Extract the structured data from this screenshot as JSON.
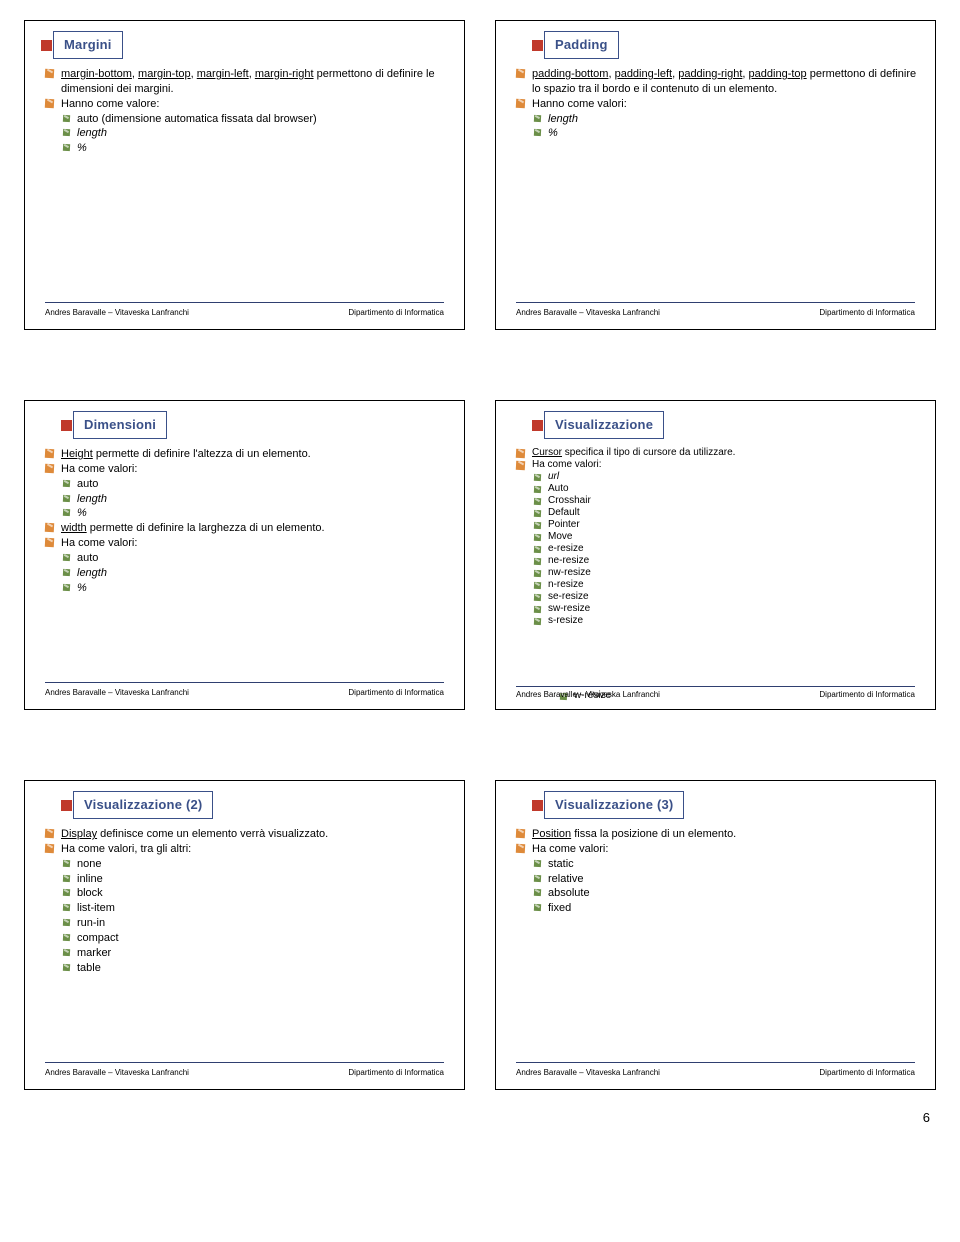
{
  "footer": {
    "left": "Andres Baravalle – Vitaveska Lanfranchi",
    "right": "Dipartimento di Informatica"
  },
  "pagenum": "6",
  "slides": [
    {
      "title": "Margini",
      "indent": false,
      "rows": [
        {
          "lvl": 1,
          "parts": [
            {
              "t": "margin-bottom",
              "c": "link"
            },
            {
              "t": ", "
            },
            {
              "t": "margin-top",
              "c": "link"
            },
            {
              "t": ", "
            },
            {
              "t": "margin-left",
              "c": "link"
            },
            {
              "t": ", "
            },
            {
              "t": "margin-right",
              "c": "link"
            },
            {
              "t": " permettono di definire le dimensioni dei margini."
            }
          ]
        },
        {
          "lvl": 1,
          "parts": [
            {
              "t": "Hanno come valore:"
            }
          ]
        },
        {
          "lvl": 2,
          "parts": [
            {
              "t": "auto (dimensione automatica fissata dal browser)"
            }
          ]
        },
        {
          "lvl": 2,
          "parts": [
            {
              "t": "length",
              "c": "em"
            }
          ]
        },
        {
          "lvl": 2,
          "parts": [
            {
              "t": "%",
              "c": "em"
            }
          ]
        }
      ]
    },
    {
      "title": "Padding",
      "indent": true,
      "rows": [
        {
          "lvl": 1,
          "parts": [
            {
              "t": "padding-bottom",
              "c": "link"
            },
            {
              "t": ", "
            },
            {
              "t": "padding-left",
              "c": "link"
            },
            {
              "t": ", "
            },
            {
              "t": "padding-right",
              "c": "link"
            },
            {
              "t": ", "
            },
            {
              "t": "padding-top",
              "c": "link"
            },
            {
              "t": " permettono di definire lo spazio tra il bordo e il contenuto di un elemento."
            }
          ]
        },
        {
          "lvl": 1,
          "parts": [
            {
              "t": "Hanno come valori:"
            }
          ]
        },
        {
          "lvl": 2,
          "parts": [
            {
              "t": "length",
              "c": "em"
            }
          ]
        },
        {
          "lvl": 2,
          "parts": [
            {
              "t": "%",
              "c": "em"
            }
          ]
        }
      ]
    },
    {
      "title": "Dimensioni",
      "indent": true,
      "rows": [
        {
          "lvl": 1,
          "parts": [
            {
              "t": "Height",
              "c": "link"
            },
            {
              "t": " permette di definire l'altezza di un elemento."
            }
          ]
        },
        {
          "lvl": 1,
          "parts": [
            {
              "t": "Ha come valori:"
            }
          ]
        },
        {
          "lvl": 2,
          "parts": [
            {
              "t": "auto"
            }
          ]
        },
        {
          "lvl": 2,
          "parts": [
            {
              "t": "length",
              "c": "em"
            }
          ]
        },
        {
          "lvl": 2,
          "parts": [
            {
              "t": "%",
              "c": "em"
            }
          ]
        },
        {
          "lvl": 1,
          "parts": [
            {
              "t": "width",
              "c": "link"
            },
            {
              "t": " permette di definire la larghezza di un elemento."
            }
          ]
        },
        {
          "lvl": 1,
          "parts": [
            {
              "t": "Ha come valori:"
            }
          ]
        },
        {
          "lvl": 2,
          "parts": [
            {
              "t": "auto"
            }
          ]
        },
        {
          "lvl": 2,
          "parts": [
            {
              "t": "length",
              "c": "em"
            }
          ]
        },
        {
          "lvl": 2,
          "parts": [
            {
              "t": "%",
              "c": "em"
            }
          ]
        }
      ]
    },
    {
      "title": "Visualizzazione",
      "indent": true,
      "tight": true,
      "overlap": "w-resize",
      "rows": [
        {
          "lvl": 1,
          "parts": [
            {
              "t": "Cursor",
              "c": "link"
            },
            {
              "t": " specifica il tipo di cursore da utilizzare."
            }
          ]
        },
        {
          "lvl": 1,
          "parts": [
            {
              "t": "Ha come valori:"
            }
          ]
        },
        {
          "lvl": 2,
          "parts": [
            {
              "t": "url",
              "c": "em"
            }
          ]
        },
        {
          "lvl": 2,
          "parts": [
            {
              "t": "Auto"
            }
          ]
        },
        {
          "lvl": 2,
          "parts": [
            {
              "t": "Crosshair"
            }
          ]
        },
        {
          "lvl": 2,
          "parts": [
            {
              "t": "Default"
            }
          ]
        },
        {
          "lvl": 2,
          "parts": [
            {
              "t": "Pointer"
            }
          ]
        },
        {
          "lvl": 2,
          "parts": [
            {
              "t": "Move"
            }
          ]
        },
        {
          "lvl": 2,
          "parts": [
            {
              "t": "e-resize"
            }
          ]
        },
        {
          "lvl": 2,
          "parts": [
            {
              "t": "ne-resize"
            }
          ]
        },
        {
          "lvl": 2,
          "parts": [
            {
              "t": "nw-resize"
            }
          ]
        },
        {
          "lvl": 2,
          "parts": [
            {
              "t": "n-resize"
            }
          ]
        },
        {
          "lvl": 2,
          "parts": [
            {
              "t": "se-resize"
            }
          ]
        },
        {
          "lvl": 2,
          "parts": [
            {
              "t": "sw-resize"
            }
          ]
        },
        {
          "lvl": 2,
          "parts": [
            {
              "t": "s-resize"
            }
          ]
        }
      ]
    },
    {
      "title": "Visualizzazione (2)",
      "indent": true,
      "rows": [
        {
          "lvl": 1,
          "parts": [
            {
              "t": "Display",
              "c": "link"
            },
            {
              "t": " definisce come un elemento verrà visualizzato."
            }
          ]
        },
        {
          "lvl": 1,
          "parts": [
            {
              "t": "Ha come valori, tra gli altri:"
            }
          ]
        },
        {
          "lvl": 2,
          "parts": [
            {
              "t": "none"
            }
          ]
        },
        {
          "lvl": 2,
          "parts": [
            {
              "t": "inline"
            }
          ]
        },
        {
          "lvl": 2,
          "parts": [
            {
              "t": "block"
            }
          ]
        },
        {
          "lvl": 2,
          "parts": [
            {
              "t": "list-item"
            }
          ]
        },
        {
          "lvl": 2,
          "parts": [
            {
              "t": "run-in"
            }
          ]
        },
        {
          "lvl": 2,
          "parts": [
            {
              "t": "compact"
            }
          ]
        },
        {
          "lvl": 2,
          "parts": [
            {
              "t": "marker"
            }
          ]
        },
        {
          "lvl": 2,
          "parts": [
            {
              "t": "table"
            }
          ]
        }
      ]
    },
    {
      "title": "Visualizzazione (3)",
      "indent": true,
      "rows": [
        {
          "lvl": 1,
          "parts": [
            {
              "t": "Position",
              "c": "link"
            },
            {
              "t": " fissa la posizione di un elemento."
            }
          ]
        },
        {
          "lvl": 1,
          "parts": [
            {
              "t": "Ha come valori:"
            }
          ]
        },
        {
          "lvl": 2,
          "parts": [
            {
              "t": "static"
            }
          ]
        },
        {
          "lvl": 2,
          "parts": [
            {
              "t": "relative"
            }
          ]
        },
        {
          "lvl": 2,
          "parts": [
            {
              "t": "absolute"
            }
          ]
        },
        {
          "lvl": 2,
          "parts": [
            {
              "t": "fixed"
            }
          ]
        }
      ]
    }
  ]
}
